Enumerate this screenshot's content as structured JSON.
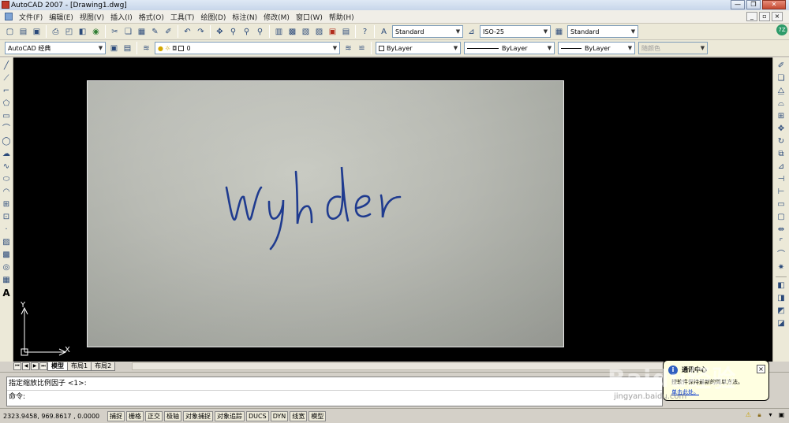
{
  "window": {
    "title": "AutoCAD 2007 - [Drawing1.dwg]",
    "minimize": "—",
    "restore": "❐",
    "close": "✕"
  },
  "menu": {
    "items": [
      "文件(F)",
      "编辑(E)",
      "视图(V)",
      "插入(I)",
      "格式(O)",
      "工具(T)",
      "绘图(D)",
      "标注(N)",
      "修改(M)",
      "窗口(W)",
      "帮助(H)"
    ]
  },
  "toolbar2": {
    "text_style": "Standard",
    "dim_style": "ISO-25",
    "table_style": "Standard"
  },
  "toolbar3": {
    "workspace": "AutoCAD 经典",
    "layer": "0",
    "color": "ByLayer",
    "linetype": "ByLayer",
    "lineweight": "ByLayer",
    "plotstyle": "随颜色"
  },
  "canvas": {
    "signature_text": "Wyhder",
    "ucs_x": "X",
    "ucs_y": "Y"
  },
  "tabs": {
    "items": [
      "模型",
      "布局1",
      "布局2"
    ],
    "active": "模型"
  },
  "command": {
    "history": "指定缩放比例因子 <1>:",
    "prompt": "命令:"
  },
  "status": {
    "coordinates": "2323.9458, 969.8617 , 0.0000",
    "buttons": [
      "捕捉",
      "栅格",
      "正交",
      "极轴",
      "对象捕捉",
      "对象追踪",
      "DUCS",
      "DYN",
      "线宽",
      "模型"
    ]
  },
  "balloon": {
    "title": "通讯中心",
    "text": "授软件保持最新的简单方法。",
    "link": "单击此处。"
  },
  "watermark": {
    "text": "Baidu经验",
    "sub": "jingyan.baidu.com"
  }
}
